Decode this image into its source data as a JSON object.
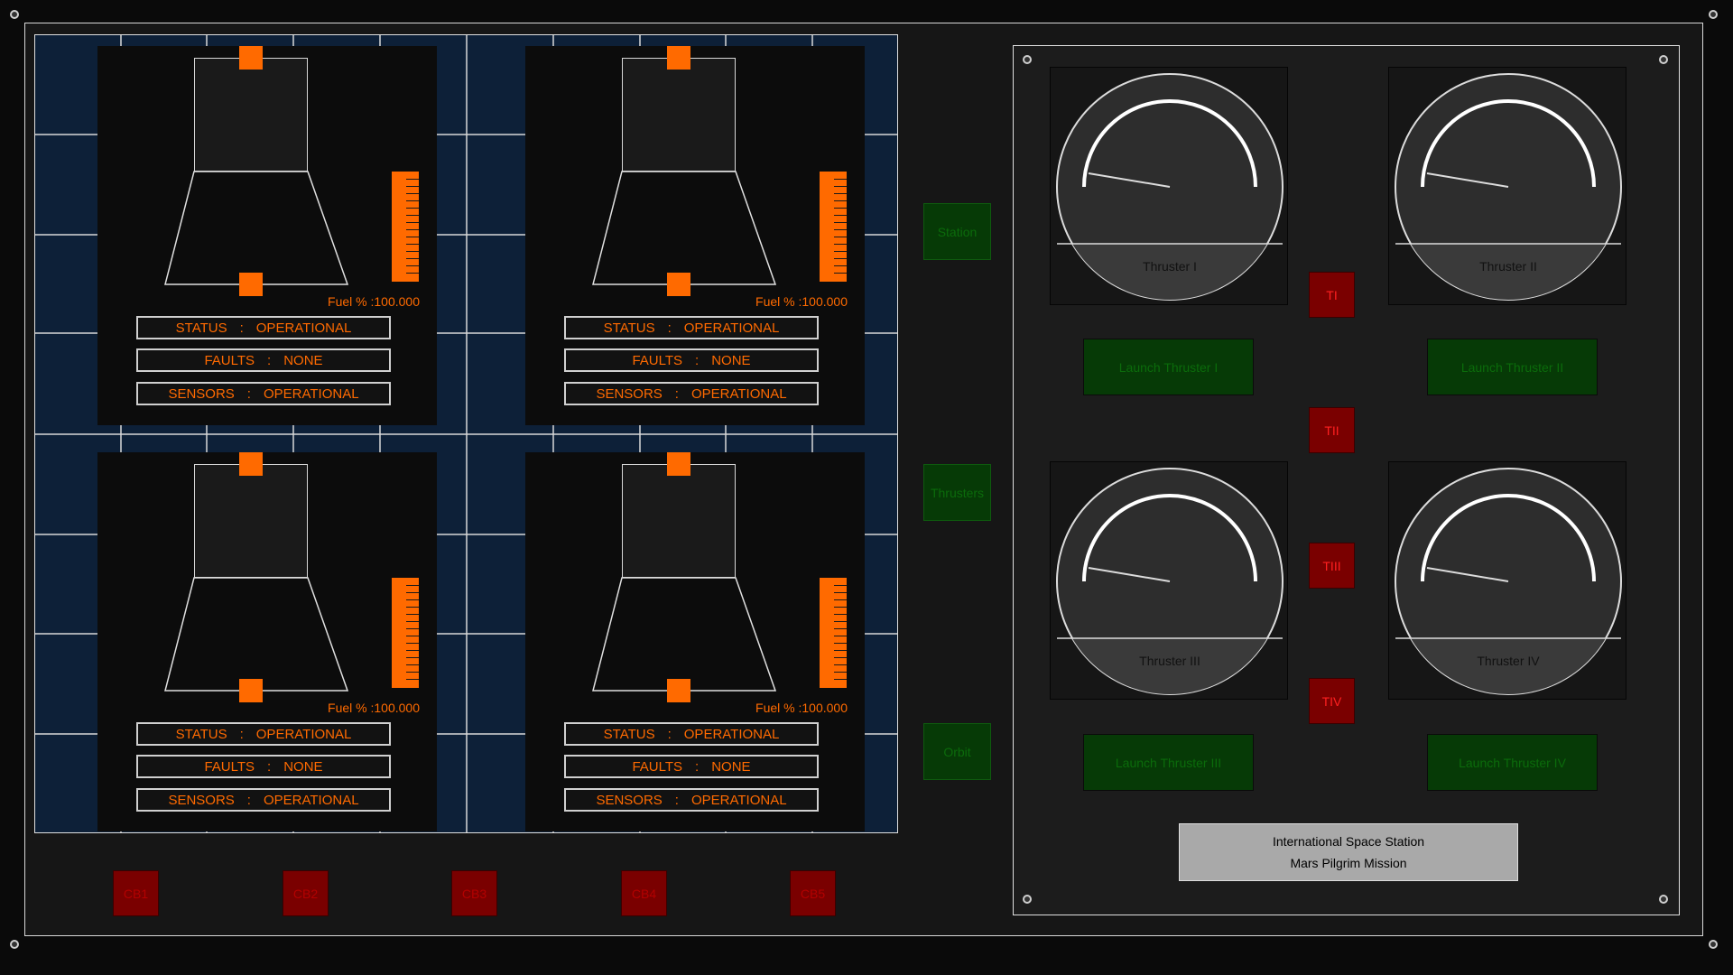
{
  "modules": [
    {
      "fuel_label": "Fuel % :100.000",
      "fuel_level": 100,
      "status_key": "STATUS",
      "status_val": "OPERATIONAL",
      "faults_key": "FAULTS",
      "faults_val": "NONE",
      "sensors_key": "SENSORS",
      "sensors_val": "OPERATIONAL",
      "sep": ":"
    },
    {
      "fuel_label": "Fuel % :100.000",
      "fuel_level": 100,
      "status_key": "STATUS",
      "status_val": "OPERATIONAL",
      "faults_key": "FAULTS",
      "faults_val": "NONE",
      "sensors_key": "SENSORS",
      "sensors_val": "OPERATIONAL",
      "sep": ":"
    },
    {
      "fuel_label": "Fuel % :100.000",
      "fuel_level": 100,
      "status_key": "STATUS",
      "status_val": "OPERATIONAL",
      "faults_key": "FAULTS",
      "faults_val": "NONE",
      "sensors_key": "SENSORS",
      "sensors_val": "OPERATIONAL",
      "sep": ":"
    },
    {
      "fuel_label": "Fuel % :100.000",
      "fuel_level": 100,
      "status_key": "STATUS",
      "status_val": "OPERATIONAL",
      "faults_key": "FAULTS",
      "faults_val": "NONE",
      "sensors_key": "SENSORS",
      "sensors_val": "OPERATIONAL",
      "sep": ":"
    }
  ],
  "circuit_breakers": [
    "CB1",
    "CB2",
    "CB3",
    "CB4",
    "CB5"
  ],
  "nav": {
    "station": "Station",
    "thrusters": "Thrusters",
    "orbit": "Orbit"
  },
  "thrusters": [
    {
      "label": "Thruster I",
      "launch": "Launch Thruster I"
    },
    {
      "label": "Thruster II",
      "launch": "Launch Thruster II"
    },
    {
      "label": "Thruster III",
      "launch": "Launch Thruster III"
    },
    {
      "label": "Thruster IV",
      "launch": "Launch Thruster IV"
    }
  ],
  "thruster_toggles": [
    "TI",
    "TII",
    "TIII",
    "TIV"
  ],
  "mission": {
    "line1": "International Space Station",
    "line2": "Mars Pilgrim Mission"
  },
  "colors": {
    "accent": "#ff6a00",
    "breaker_red": "#7a0000",
    "nav_green": "#063a06",
    "grid_blue": "#0d2038"
  }
}
